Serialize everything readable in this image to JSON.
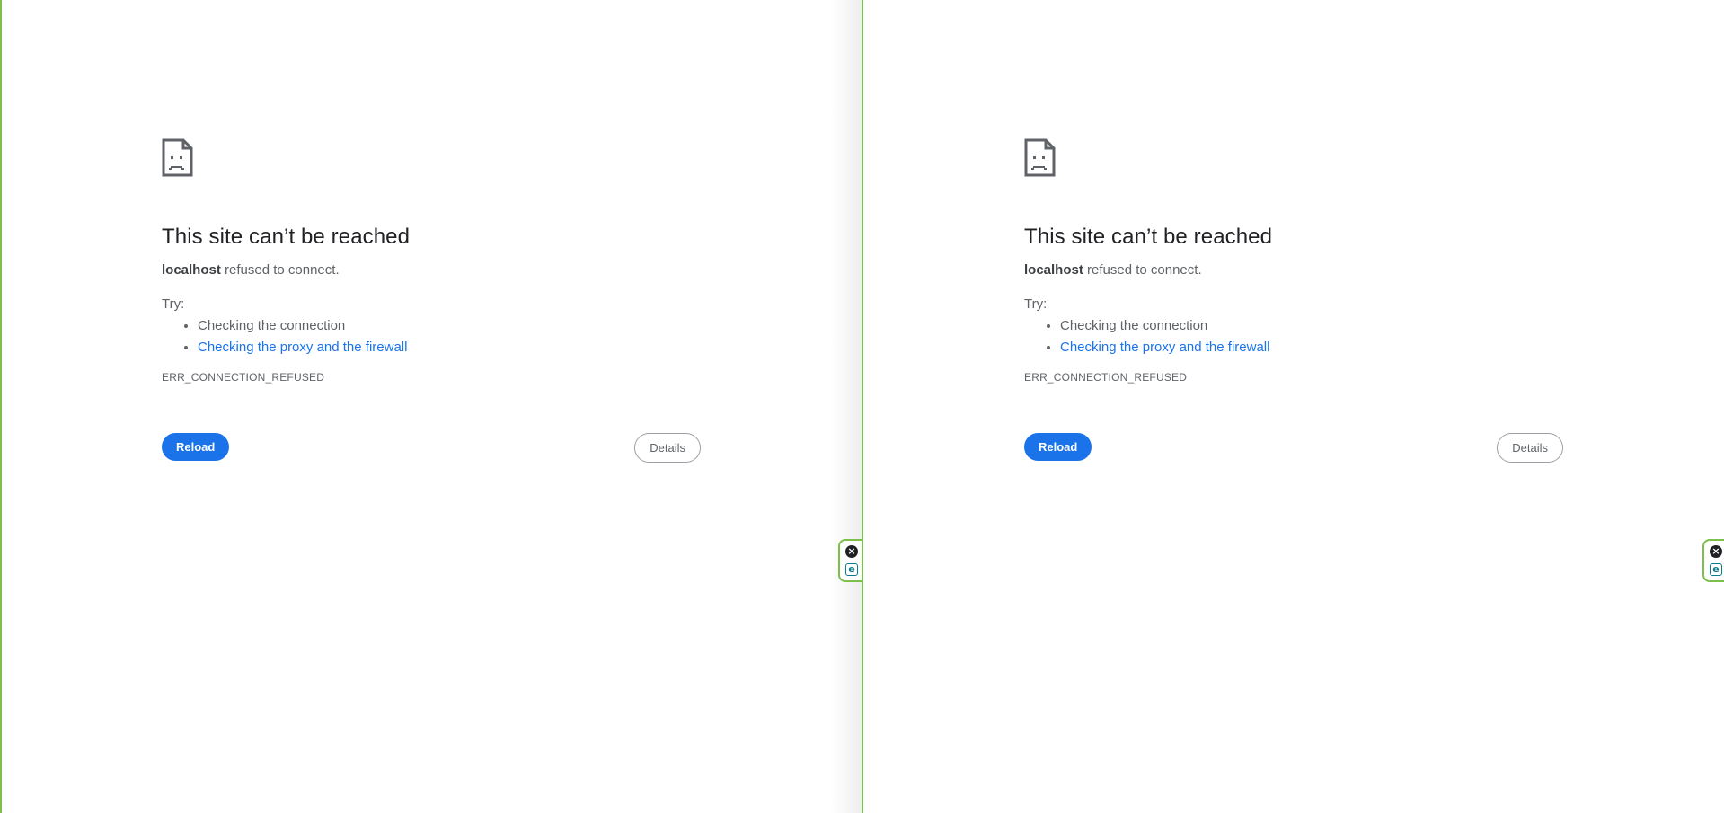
{
  "panes": [
    {
      "title": "This site can’t be reached",
      "host": "localhost",
      "summary_rest": " refused to connect.",
      "try_label": "Try:",
      "suggestions": [
        {
          "text": "Checking the connection"
        },
        {
          "text": "Checking the proxy and the firewall"
        }
      ],
      "error_code": "ERR_CONNECTION_REFUSED",
      "reload_label": "Reload",
      "details_label": "Details"
    },
    {
      "title": "This site can’t be reached",
      "host": "localhost",
      "summary_rest": " refused to connect.",
      "try_label": "Try:",
      "suggestions": [
        {
          "text": "Checking the connection"
        },
        {
          "text": "Checking the proxy and the firewall"
        }
      ],
      "error_code": "ERR_CONNECTION_REFUSED",
      "reload_label": "Reload",
      "details_label": "Details"
    }
  ],
  "widget": {
    "close_glyph": "×",
    "extension_glyph": "e"
  },
  "colors": {
    "accent_blue": "#1a73e8",
    "pane_border_green": "#7cc04a",
    "text_primary": "#202124",
    "text_secondary": "#5f6368"
  },
  "icons": {
    "error_icon": "sad-document-icon",
    "widget_close": "close-circle-icon",
    "widget_extension": "extension-e-icon"
  }
}
